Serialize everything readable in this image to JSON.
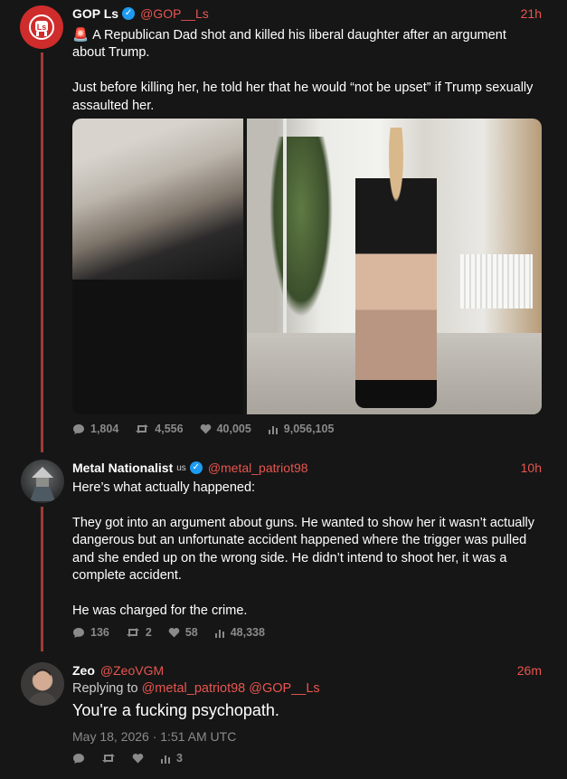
{
  "tweets": [
    {
      "name": "GOP Ls",
      "handle": "@GOP__Ls",
      "time": "21h",
      "paragraphs": [
        "A Republican Dad shot and killed his liberal daughter after an argument about Trump.",
        "Just before killing her, he told her that he would “not be upset” if Trump sexually assaulted her."
      ],
      "stats": {
        "replies": "1,804",
        "retweets": "4,556",
        "likes": "40,005",
        "views": "9,056,105"
      }
    },
    {
      "name": "Metal Nationalist",
      "flag": "us",
      "handle": "@metal_patriot98",
      "time": "10h",
      "paragraphs": [
        "Here’s what actually happened:",
        "They got into an argument about guns. He wanted to show her it wasn’t actually dangerous but an unfortunate accident happened where the trigger was pulled and she ended up on the wrong side. He didn’t intend to shoot her, it was a complete accident.",
        "He was charged for the crime."
      ],
      "stats": {
        "replies": "136",
        "retweets": "2",
        "likes": "58",
        "views": "48,338"
      }
    },
    {
      "name": "Zeo",
      "handle": "@ZeoVGM",
      "time": "26m",
      "replying_label": "Replying to",
      "replying_handles": "@metal_patriot98 @GOP__Ls",
      "text": "You're a fucking psychopath.",
      "date": "May 18, 2026 · 1:51 AM UTC",
      "stats": {
        "views": "3"
      }
    }
  ],
  "icons": {
    "reply": "💬",
    "retweet": "⇄",
    "like": "♥",
    "views": "📊",
    "siren": "🚨",
    "verified": "✓"
  },
  "colors": {
    "accent": "#e8554f",
    "thread": "#a23b37",
    "verified": "#1d9bf0"
  }
}
